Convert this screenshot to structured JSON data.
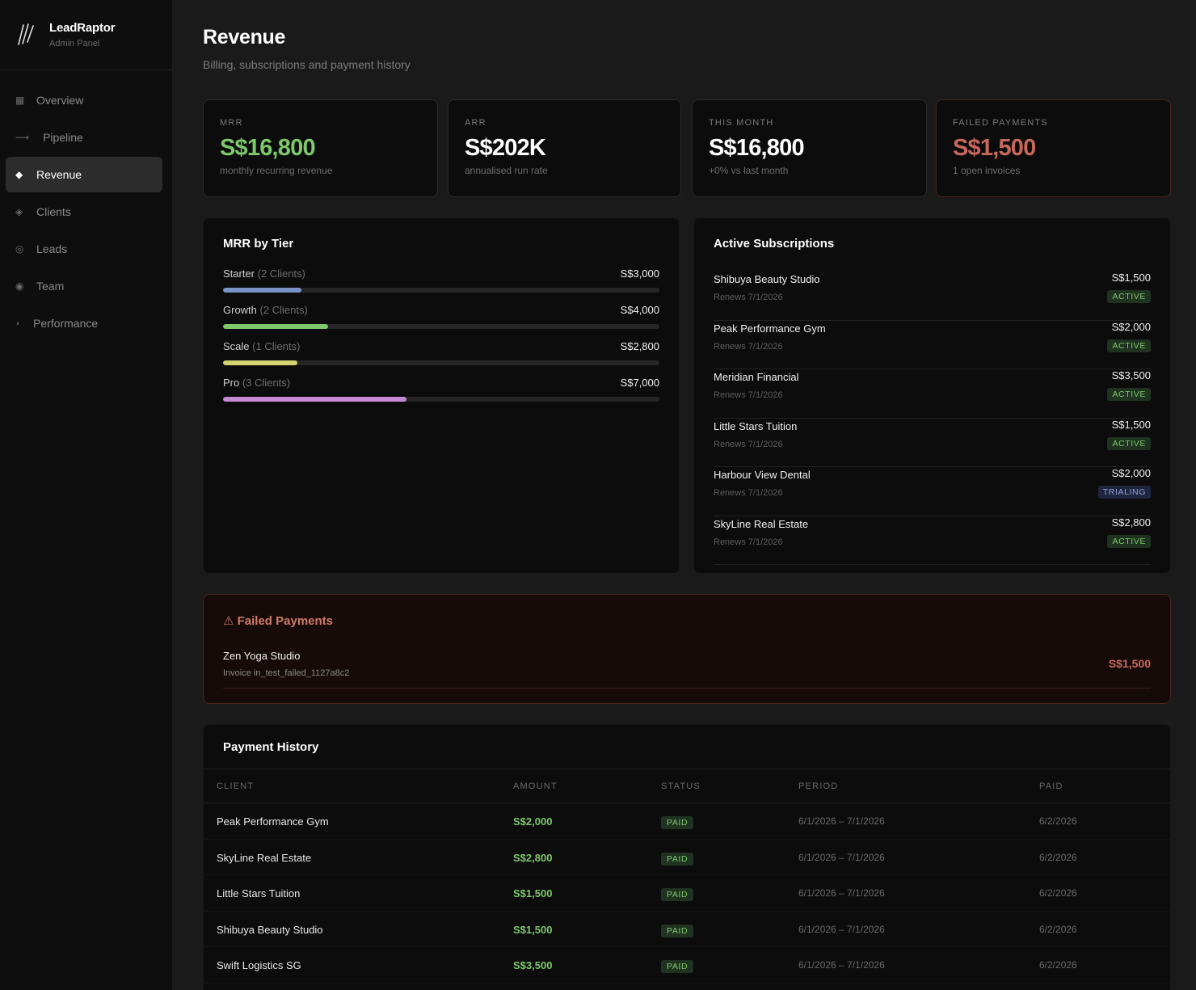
{
  "brand": {
    "name": "LeadRaptor",
    "sub": "Admin Panel"
  },
  "nav": [
    {
      "label": "Overview",
      "icon": "grid-icon"
    },
    {
      "label": "Pipeline",
      "icon": "arrow-right-icon"
    },
    {
      "label": "Revenue",
      "icon": "diamond-icon",
      "active": true
    },
    {
      "label": "Clients",
      "icon": "diamond-outline-icon"
    },
    {
      "label": "Leads",
      "icon": "target-icon"
    },
    {
      "label": "Team",
      "icon": "circle-icon"
    },
    {
      "label": "Performance",
      "icon": "half-circle-icon"
    }
  ],
  "header": {
    "title": "Revenue",
    "subtitle": "Billing, subscriptions and payment history"
  },
  "kpis": [
    {
      "label": "MRR",
      "value": "S$16,800",
      "note": "monthly recurring revenue",
      "tone": "green"
    },
    {
      "label": "ARR",
      "value": "S$202K",
      "note": "annualised run rate",
      "tone": "white"
    },
    {
      "label": "THIS MONTH",
      "value": "S$16,800",
      "note": "+0% vs last month",
      "tone": "white"
    },
    {
      "label": "FAILED PAYMENTS",
      "value": "S$1,500",
      "note": "1 open invoices",
      "tone": "red"
    }
  ],
  "tiers": {
    "title": "MRR by Tier",
    "items": [
      {
        "name": "Starter",
        "clients": "(2 Clients)",
        "amount": "S$3,000",
        "share": 0.18,
        "color": "#7a94c8"
      },
      {
        "name": "Growth",
        "clients": "(2 Clients)",
        "amount": "S$4,000",
        "share": 0.24,
        "color": "#7ec86c"
      },
      {
        "name": "Scale",
        "clients": "(1 Clients)",
        "amount": "S$2,800",
        "share": 0.17,
        "color": "#d4d470"
      },
      {
        "name": "Pro",
        "clients": "(3 Clients)",
        "amount": "S$7,000",
        "share": 0.42,
        "color": "#c48ad4"
      }
    ]
  },
  "subscriptions": {
    "title": "Active Subscriptions",
    "items": [
      {
        "name": "Shibuya Beauty Studio",
        "renews": "Renews 7/1/2026",
        "amount": "S$1,500",
        "status": "ACTIVE"
      },
      {
        "name": "Peak Performance Gym",
        "renews": "Renews 7/1/2026",
        "amount": "S$2,000",
        "status": "ACTIVE"
      },
      {
        "name": "Meridian Financial",
        "renews": "Renews 7/1/2026",
        "amount": "S$3,500",
        "status": "ACTIVE"
      },
      {
        "name": "Little Stars Tuition",
        "renews": "Renews 7/1/2026",
        "amount": "S$1,500",
        "status": "ACTIVE"
      },
      {
        "name": "Harbour View Dental",
        "renews": "Renews 7/1/2026",
        "amount": "S$2,000",
        "status": "TRIALING"
      },
      {
        "name": "SkyLine Real Estate",
        "renews": "Renews 7/1/2026",
        "amount": "S$2,800",
        "status": "ACTIVE"
      }
    ]
  },
  "failed": {
    "title": "⚠ Failed Payments",
    "items": [
      {
        "name": "Zen Yoga Studio",
        "invoice": "Invoice in_test_failed_1127a8c2",
        "amount": "S$1,500"
      }
    ]
  },
  "history": {
    "title": "Payment History",
    "columns": [
      "CLIENT",
      "AMOUNT",
      "STATUS",
      "PERIOD",
      "PAID"
    ],
    "rows": [
      {
        "client": "Peak Performance Gym",
        "amount": "S$2,000",
        "status": "PAID",
        "period": "6/1/2026 – 7/1/2026",
        "paid": "6/2/2026"
      },
      {
        "client": "SkyLine Real Estate",
        "amount": "S$2,800",
        "status": "PAID",
        "period": "6/1/2026 – 7/1/2026",
        "paid": "6/2/2026"
      },
      {
        "client": "Little Stars Tuition",
        "amount": "S$1,500",
        "status": "PAID",
        "period": "6/1/2026 – 7/1/2026",
        "paid": "6/2/2026"
      },
      {
        "client": "Shibuya Beauty Studio",
        "amount": "S$1,500",
        "status": "PAID",
        "period": "6/1/2026 – 7/1/2026",
        "paid": "6/2/2026"
      },
      {
        "client": "Swift Logistics SG",
        "amount": "S$3,500",
        "status": "PAID",
        "period": "6/1/2026 – 7/1/2026",
        "paid": "6/2/2026"
      }
    ]
  }
}
